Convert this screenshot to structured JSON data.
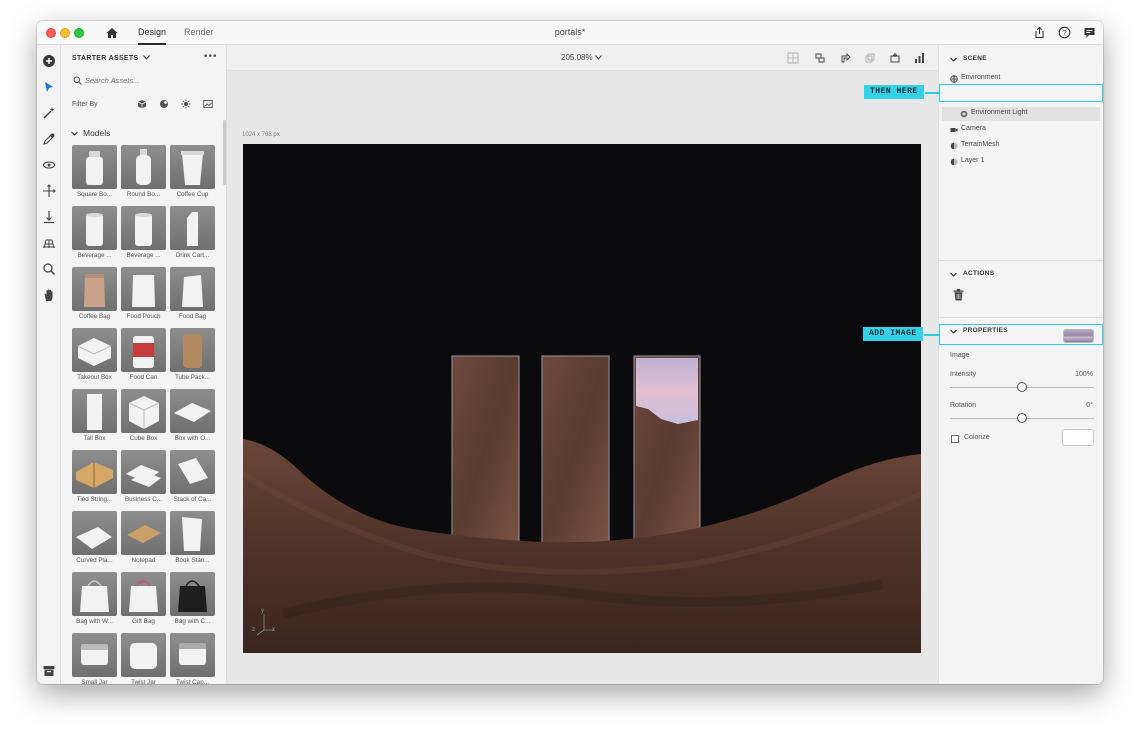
{
  "titlebar": {
    "document_title": "portals*",
    "tabs": [
      {
        "label": "Design"
      },
      {
        "label": "Render"
      }
    ],
    "icons": [
      "home-icon",
      "share-icon",
      "help-icon",
      "feedback-icon"
    ]
  },
  "tools": [
    "add-icon",
    "select-icon",
    "magic-wand-icon",
    "eyedropper-icon",
    "orbit-icon",
    "move-icon",
    "drop-to-ground-icon",
    "grid-icon",
    "zoom-icon",
    "hand-icon",
    "archive-icon"
  ],
  "assets": {
    "header": "STARTER ASSETS",
    "more": "•••",
    "search_placeholder": "Search Assets...",
    "filter_label": "Filter By",
    "section": "Models",
    "items": [
      {
        "label": "Square Bo..."
      },
      {
        "label": "Round Bo..."
      },
      {
        "label": "Coffee Cup"
      },
      {
        "label": "Beverage ..."
      },
      {
        "label": "Beverage ..."
      },
      {
        "label": "Drink Cart..."
      },
      {
        "label": "Coffee Bag"
      },
      {
        "label": "Food Pouch"
      },
      {
        "label": "Food Bag"
      },
      {
        "label": "Takeout Box"
      },
      {
        "label": "Food Can"
      },
      {
        "label": "Tube Pack..."
      },
      {
        "label": "Tall Box"
      },
      {
        "label": "Cube Box"
      },
      {
        "label": "Box with O..."
      },
      {
        "label": "Tied String..."
      },
      {
        "label": "Business C..."
      },
      {
        "label": "Stack of Ca..."
      },
      {
        "label": "Curved Pla..."
      },
      {
        "label": "Notepad"
      },
      {
        "label": "Book Stan..."
      },
      {
        "label": "Bag with W..."
      },
      {
        "label": "Gift Bag"
      },
      {
        "label": "Bag with C..."
      },
      {
        "label": "Small Jar"
      },
      {
        "label": "Twist Jar"
      },
      {
        "label": "Twist Cap..."
      }
    ]
  },
  "viewport": {
    "zoom": "205.08%",
    "canvas_size": "1024 x 768 px",
    "axis_labels": {
      "z": "z",
      "y": "y",
      "x": "x"
    }
  },
  "scene_panel": {
    "title": "SCENE",
    "items": [
      {
        "label": "Environment",
        "icon": "globe-icon"
      },
      {
        "label": "Environment Light",
        "icon": "light-icon",
        "selected": true
      },
      {
        "label": "Camera",
        "icon": "camera-icon"
      },
      {
        "label": "TerrainMesh",
        "icon": "mesh-icon"
      },
      {
        "label": "Layer 1",
        "icon": "layer-icon"
      }
    ]
  },
  "actions_panel": {
    "title": "ACTIONS"
  },
  "properties_panel": {
    "title": "PROPERTIES",
    "image_label": "Image",
    "intensity_label": "Intensity",
    "intensity_value": "100%",
    "intensity_level": 0.5,
    "rotation_label": "Rotation",
    "rotation_value": "0°",
    "rotation_level": 0.5,
    "colorize_label": "Colorize",
    "colorize_checked": false
  },
  "callouts": [
    {
      "label": "THEN HERE"
    },
    {
      "label": "ADD IMAGE"
    }
  ],
  "colors": {
    "accent_callout": "#34d2e8",
    "scene_bg": "#0b0b0e",
    "terrain": "#5a3a30"
  }
}
